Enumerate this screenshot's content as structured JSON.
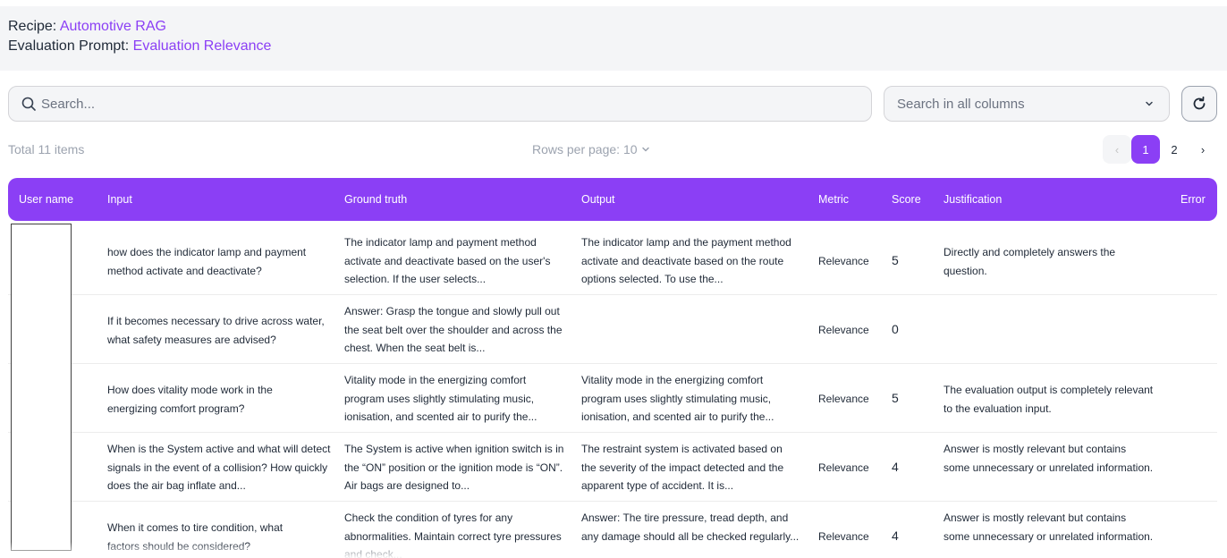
{
  "header": {
    "recipe_label": "Recipe:",
    "recipe_value": "Automotive RAG",
    "prompt_label": "Evaluation Prompt:",
    "prompt_value": "Evaluation Relevance"
  },
  "search": {
    "placeholder": "Search..."
  },
  "column_select": {
    "value": "Search in all columns"
  },
  "summary": {
    "total": "Total 11 items",
    "rows_per_page": "Rows per page: 10"
  },
  "pagination": {
    "prev": "‹",
    "pages": [
      "1",
      "2"
    ],
    "active": "1",
    "next": "›"
  },
  "columns": [
    "User name",
    "Input",
    "Ground truth",
    "Output",
    "Metric",
    "Score",
    "Justification",
    "Error"
  ],
  "rows": [
    {
      "input": "how does the indicator lamp and payment method activate and deactivate?",
      "ground_truth": "The indicator lamp and payment method activate and deactivate based on the user's selection. If the user selects...",
      "output": "The indicator lamp and the payment method activate and deactivate based on the route options selected. To use the...",
      "metric": "Relevance",
      "score": "5",
      "justification": "Directly and completely answers the question."
    },
    {
      "input": "If it becomes necessary to drive across water, what safety measures are advised?",
      "ground_truth": "Answer: Grasp the tongue and slowly pull out the seat belt over the shoulder and across the chest. When the seat belt is...",
      "output": "",
      "metric": "Relevance",
      "score": "0",
      "justification": ""
    },
    {
      "input": "How does vitality mode work in the energizing comfort program?",
      "ground_truth": "Vitality mode in the energizing comfort program uses slightly stimulating music, ionisation, and scented air to purify the...",
      "output": "Vitality mode in the energizing comfort program uses slightly stimulating music, ionisation, and scented air to purify the...",
      "metric": "Relevance",
      "score": "5",
      "justification": "The evaluation output is completely relevant to the evaluation input."
    },
    {
      "input": "When is the System active and what will detect signals in the event of a collision? How quickly does the air bag inflate and...",
      "ground_truth": "The System is active when ignition switch is in the “ON” position or the ignition mode is “ON”. Air bags are designed to...",
      "output": "The restraint system is activated based on the severity of the impact detected and the apparent type of accident. It is...",
      "metric": "Relevance",
      "score": "4",
      "justification": "Answer is mostly relevant but contains some unnecessary or unrelated information."
    },
    {
      "input": "When it comes to tire condition, what factors should be considered?",
      "ground_truth": "Check the condition of tyres for any abnormalities. Maintain correct tyre pressures and check...",
      "output": "Answer: The tire pressure, tread depth, and any damage should all be checked regularly...",
      "metric": "Relevance",
      "score": "4",
      "justification": "Answer is mostly relevant but contains some unnecessary or unrelated information."
    }
  ],
  "colors": {
    "accent": "#8b3ff5",
    "header_bg": "#f4f5f7"
  },
  "icons": {
    "search": "search-icon",
    "dropdown": "chevron-down-icon",
    "refresh": "refresh-icon"
  }
}
